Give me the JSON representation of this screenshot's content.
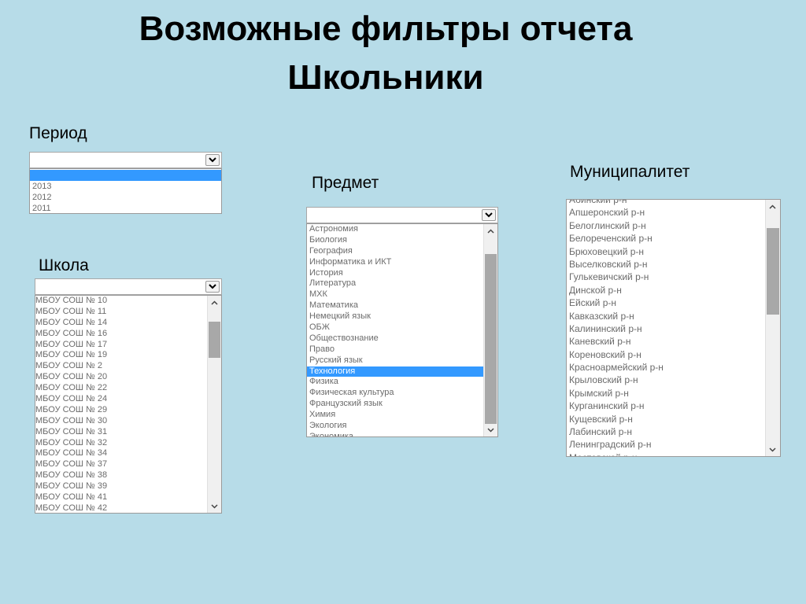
{
  "title": {
    "line1": "Возможные фильтры отчета",
    "line2": "Школьники"
  },
  "period": {
    "label": "Период",
    "value": "",
    "options": [
      "",
      "2013",
      "2012",
      "2011"
    ],
    "selected_index": 0
  },
  "school": {
    "label": "Школа",
    "value": "",
    "options": [
      "МБОУ СОШ № 10",
      "МБОУ СОШ № 11",
      "МБОУ СОШ № 14",
      "МБОУ СОШ № 16",
      "МБОУ СОШ № 17",
      "МБОУ СОШ № 19",
      "МБОУ СОШ № 2",
      "МБОУ СОШ № 20",
      "МБОУ СОШ № 22",
      "МБОУ СОШ № 24",
      "МБОУ СОШ № 29",
      "МБОУ СОШ № 30",
      "МБОУ СОШ № 31",
      "МБОУ СОШ № 32",
      "МБОУ СОШ № 34",
      "МБОУ СОШ № 37",
      "МБОУ СОШ № 38",
      "МБОУ СОШ № 39",
      "МБОУ СОШ № 41",
      "МБОУ СОШ № 42"
    ]
  },
  "subject": {
    "label": "Предмет",
    "value": "",
    "options": [
      "Астрономия",
      "Биология",
      "География",
      "Информатика и ИКТ",
      "История",
      "Литература",
      "МХК",
      "Математика",
      "Немецкий язык",
      "ОБЖ",
      "Обществознание",
      "Право",
      "Русский язык",
      "Технология",
      "Физика",
      "Физическая культура",
      "Французский язык",
      "Химия",
      "Экология",
      "Экономика"
    ],
    "selected": "Технология"
  },
  "municipality": {
    "label": "Муниципалитет",
    "options": [
      "Абинский р-н",
      "Апшеронский р-н",
      "Белоглинский р-н",
      "Белореченский р-н",
      "Брюховецкий р-н",
      "Выселковский р-н",
      "Гулькевичский р-н",
      "Динской р-н",
      "Ейский р-н",
      "Кавказский р-н",
      "Калининский р-н",
      "Каневский р-н",
      "Кореновский р-н",
      "Красноармейский р-н",
      "Крыловский р-н",
      "Крымский р-н",
      "Курганинский р-н",
      "Кущевский р-н",
      "Лабинский р-н",
      "Ленинградский р-н",
      "Мостовской р-н"
    ]
  },
  "icons": {
    "dropdown": "chevron-down-icon",
    "scroll_up": "chevron-up-icon",
    "scroll_down": "chevron-down-icon"
  }
}
